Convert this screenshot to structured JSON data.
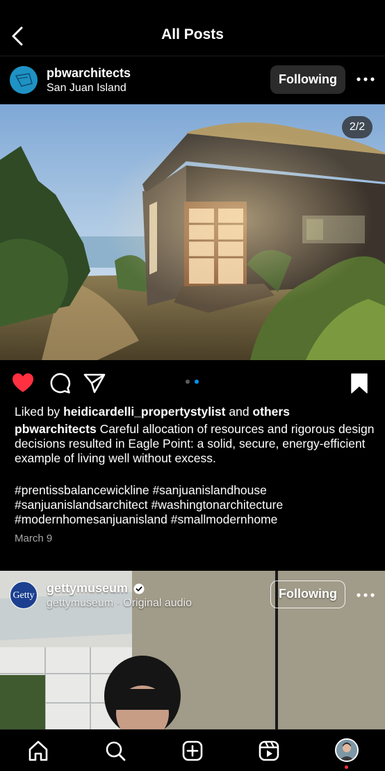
{
  "header": {
    "title": "All Posts"
  },
  "post1": {
    "username": "pbwarchitects",
    "location": "San Juan Island",
    "follow_label": "Following",
    "image_counter": "2/2",
    "carousel": {
      "count": 2,
      "active_index": 1
    },
    "liked_by_prefix": "Liked by",
    "liked_by_user": "heidicardelli_propertystylist",
    "liked_by_middle": "and",
    "liked_by_others": "others",
    "caption_user": "pbwarchitects",
    "caption": "Careful allocation of resources and rigorous design decisions resulted in Eagle Point: a solid, secure, energy-efficient example of living well without excess.",
    "hashtags_line1": "#prentissbalancewickline #sanjuanislandhouse",
    "hashtags_line2": "#sanjuanislandsarchitect #washingtonarchitecture",
    "hashtags_line3": "#modernhomesanjuanisland #smallmodernhome",
    "date": "March 9",
    "liked": true,
    "saved": true
  },
  "post2": {
    "avatar_text": "Getty",
    "username": "gettymuseum",
    "subtitle": "gettymuseum · Original audio",
    "follow_label": "Following",
    "verified": true
  },
  "colors": {
    "background": "#000000",
    "like_red": "#ff3040",
    "carousel_active": "#0095f6",
    "carousel_inactive": "#5a5a5a",
    "notification_dot": "#ff3040"
  },
  "icons": {
    "back": "chevron-left-icon",
    "more": "ellipsis-icon",
    "like": "heart-filled-icon",
    "comment": "comment-bubble-icon",
    "share": "paper-plane-icon",
    "save": "bookmark-filled-icon",
    "verified": "verified-badge-icon",
    "nav": [
      "home-icon",
      "search-icon",
      "create-icon",
      "reels-icon",
      "profile-avatar"
    ]
  }
}
